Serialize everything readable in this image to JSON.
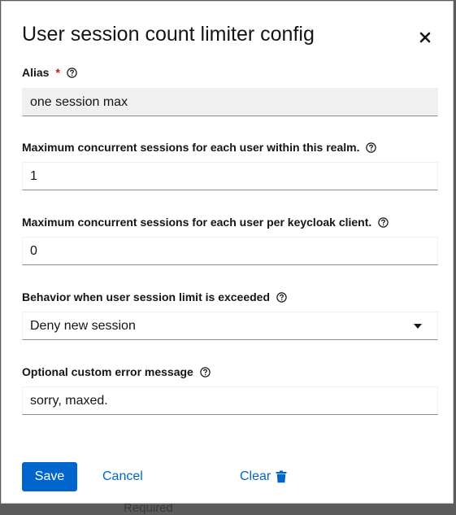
{
  "backdrop": {
    "partial_text": "Required"
  },
  "dialog": {
    "title": "User session count limiter config",
    "close_icon": "close-icon"
  },
  "fields": {
    "alias": {
      "label": "Alias",
      "required_mark": "*",
      "value": "one session max"
    },
    "max_realm": {
      "label": "Maximum concurrent sessions for each user within this realm.",
      "value": "1"
    },
    "max_client": {
      "label": "Maximum concurrent sessions for each user per keycloak client.",
      "value": "0"
    },
    "behavior": {
      "label": "Behavior when user session limit is exceeded",
      "value": "Deny new session"
    },
    "error_message": {
      "label": "Optional custom error message",
      "value": "sorry, maxed."
    }
  },
  "actions": {
    "save_label": "Save",
    "cancel_label": "Cancel",
    "clear_label": "Clear"
  },
  "colors": {
    "primary": "#0066cc",
    "required": "#c9190b",
    "readonly_bg": "#f0f0f0"
  }
}
